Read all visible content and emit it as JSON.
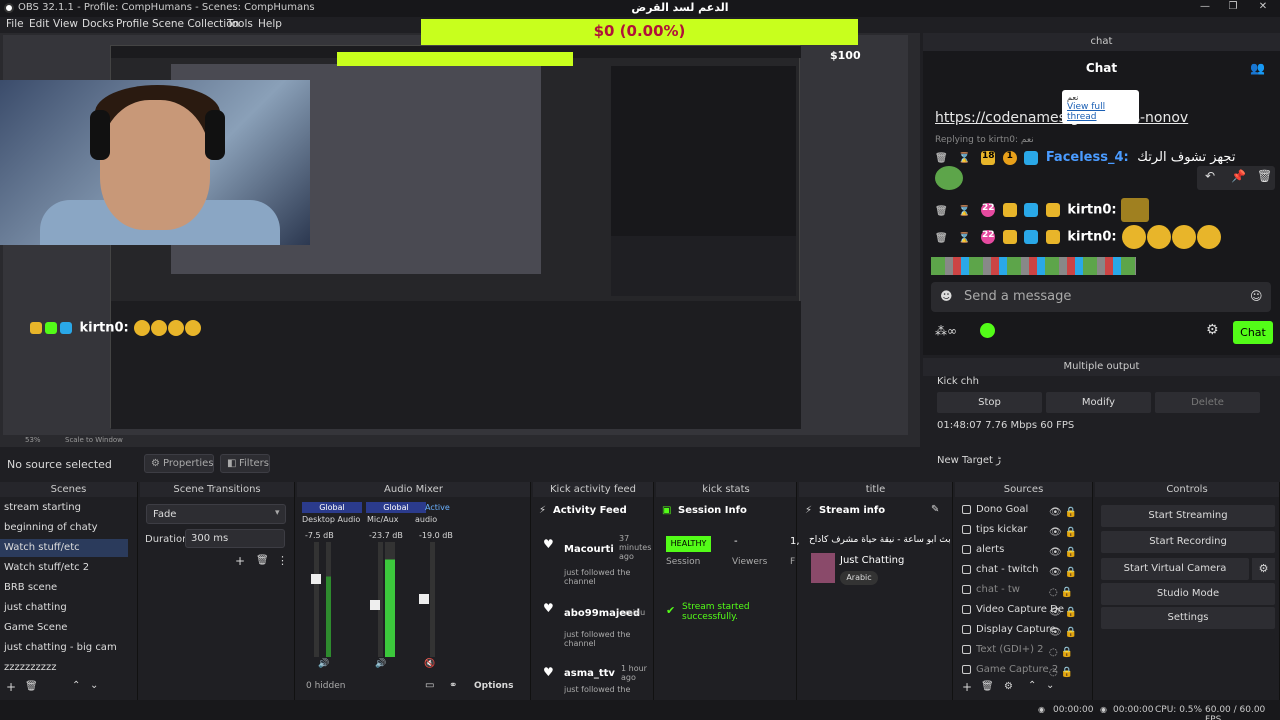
{
  "window": {
    "title": "OBS 32.1.1 - Profile: CompHumans - Scenes: CompHumans",
    "min": "—",
    "max": "❐",
    "close": "✕"
  },
  "menu": [
    "File",
    "Edit",
    "View",
    "Docks",
    "Profile",
    "Scene Collection",
    "Tools",
    "Help"
  ],
  "goal": {
    "title": "الدعم لسد القرض",
    "value": "$0 (0.00%)",
    "max": "$100",
    "accent": "#c8ff1d"
  },
  "overlay_chat": {
    "user": "kirtn0:"
  },
  "preview": {
    "zoom": "53%",
    "scale": "Scale to Window"
  },
  "source_bar": {
    "label": "No source selected",
    "properties": "Properties",
    "filters": "Filters"
  },
  "chat": {
    "dock_title": "chat",
    "title": "Chat",
    "link": "https://codenames.g",
    "link_tail": "s-nonov",
    "tooltip_top": "نعم",
    "tooltip_link": "View full thread",
    "replying": "Replying to kirtn0: نعم",
    "messages": [
      {
        "badges": [
          "18",
          "1"
        ],
        "user": "Faceless_4:",
        "text": "تجهز تشوف الرتك",
        "color": "#4a9bff"
      },
      {
        "badges": [
          "22"
        ],
        "user": "kirtn0:",
        "text": "",
        "color": "#ffffff"
      },
      {
        "badges": [
          "22"
        ],
        "user": "kirtn0:",
        "text": "",
        "color": "#ffffff"
      }
    ],
    "send_placeholder": "Send a message",
    "send_button": "Chat",
    "accent": "#53fc18"
  },
  "multiple_output": {
    "title": "Multiple output",
    "target": "Kick chh",
    "buttons": [
      "Stop",
      "Modify",
      "Delete"
    ],
    "stats": "01:48:07  7.76 Mbps  60 FPS",
    "new_target": "New Target ڑ"
  },
  "docks": {
    "scenes": {
      "title": "Scenes",
      "items": [
        "stream starting",
        "beginning of chaty",
        "Watch stuff/etc",
        "Watch stuff/etc 2",
        "BRB scene",
        "just chatting",
        "Game Scene",
        "just chatting - big cam",
        "zzzzzzzzzz"
      ],
      "selected": "Watch stuff/etc"
    },
    "transitions": {
      "title": "Scene Transitions",
      "type": "Fade",
      "duration_label": "Duration",
      "duration": "300 ms"
    },
    "audio": {
      "title": "Audio Mixer",
      "tabs": [
        "Global",
        "Global",
        "Active"
      ],
      "channels": [
        {
          "name": "Desktop Audio",
          "db": "-7.5 dB"
        },
        {
          "name": "Mic/Aux",
          "db": "-23.7 dB"
        },
        {
          "name": "audio",
          "db": "-19.0 dB"
        }
      ],
      "scale": [
        "0",
        "-6",
        "-12",
        "-18",
        "-24",
        "-30",
        "-36",
        "-42",
        "-48",
        "-54",
        "-60"
      ],
      "hidden": "0 hidden",
      "options": "Options"
    },
    "activity": {
      "title": "Kick activity feed",
      "header": "Activity Feed",
      "items": [
        {
          "user": "Macourti",
          "time": "37 minutes ago",
          "text": "just followed the channel"
        },
        {
          "user": "abo99majeed",
          "time": "minu",
          "text": "just followed the channel"
        },
        {
          "user": "asma_ttv",
          "time": "1 hour ago",
          "text": "just followed the"
        }
      ]
    },
    "stats": {
      "title": "kick stats",
      "header": "Session Info",
      "status": "HEALTHY",
      "session": "Session",
      "viewers_value": "-",
      "viewers": "Viewers",
      "message": "Stream started successfully.",
      "col3": "1,",
      "col3b": "F"
    },
    "title_dock": {
      "title": "title",
      "header": "Stream info",
      "stream_title": "بث ابو ساعة - نيقة حياة مشرف كاداح",
      "category": "Just Chatting",
      "language": "Arabic"
    },
    "sources": {
      "title": "Sources",
      "items": [
        "Dono Goal",
        "tips kickar",
        "alerts",
        "chat - twitch",
        "chat - tw",
        "Video Capture De",
        "Display Capture",
        "Text (GDI+) 2",
        "Game Capture 2"
      ]
    },
    "controls": {
      "title": "Controls",
      "buttons": [
        "Start Streaming",
        "Start Recording",
        "Start Virtual Camera",
        "Studio Mode",
        "Settings"
      ]
    }
  },
  "status": {
    "time1": "00:00:00",
    "time2": "00:00:00",
    "cpu": "CPU: 0.5%",
    "fps": "60.00 / 60.00 FPS"
  }
}
